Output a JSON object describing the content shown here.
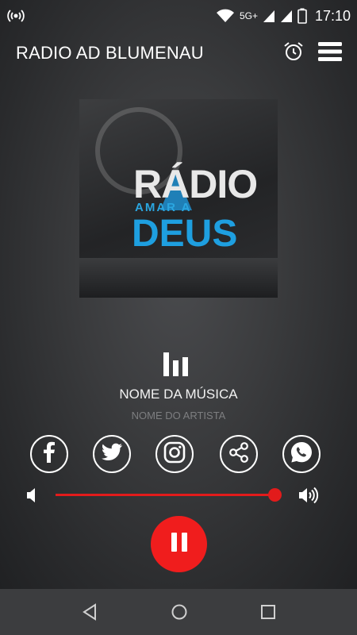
{
  "status_bar": {
    "network_label": "5G+",
    "time": "17:10",
    "icons": [
      "broadcast-icon",
      "wifi-icon",
      "signal-icon",
      "signal-icon",
      "battery-icon"
    ]
  },
  "app_bar": {
    "title": "RADIO AD BLUMENAU",
    "icons": [
      "alarm-clock-icon",
      "menu-icon"
    ]
  },
  "album_art": {
    "logo_line1": "RÁDIO",
    "logo_line2": "AMAR A",
    "logo_line3": "DEUS"
  },
  "now_playing": {
    "song": "NOME DA MÚSICA",
    "artist": "NOME DO ARTISTA"
  },
  "social": [
    "facebook-icon",
    "twitter-icon",
    "instagram-icon",
    "share-icon",
    "whatsapp-icon"
  ],
  "volume": {
    "level": 1.0
  },
  "player": {
    "state": "playing",
    "button_icon": "pause-icon"
  },
  "nav_bar": [
    "back-icon",
    "home-icon",
    "recents-icon"
  ],
  "colors": {
    "accent": "#f01d1d",
    "logo_blue": "#1e9fe0",
    "nav_bg": "#3c3d3f"
  }
}
